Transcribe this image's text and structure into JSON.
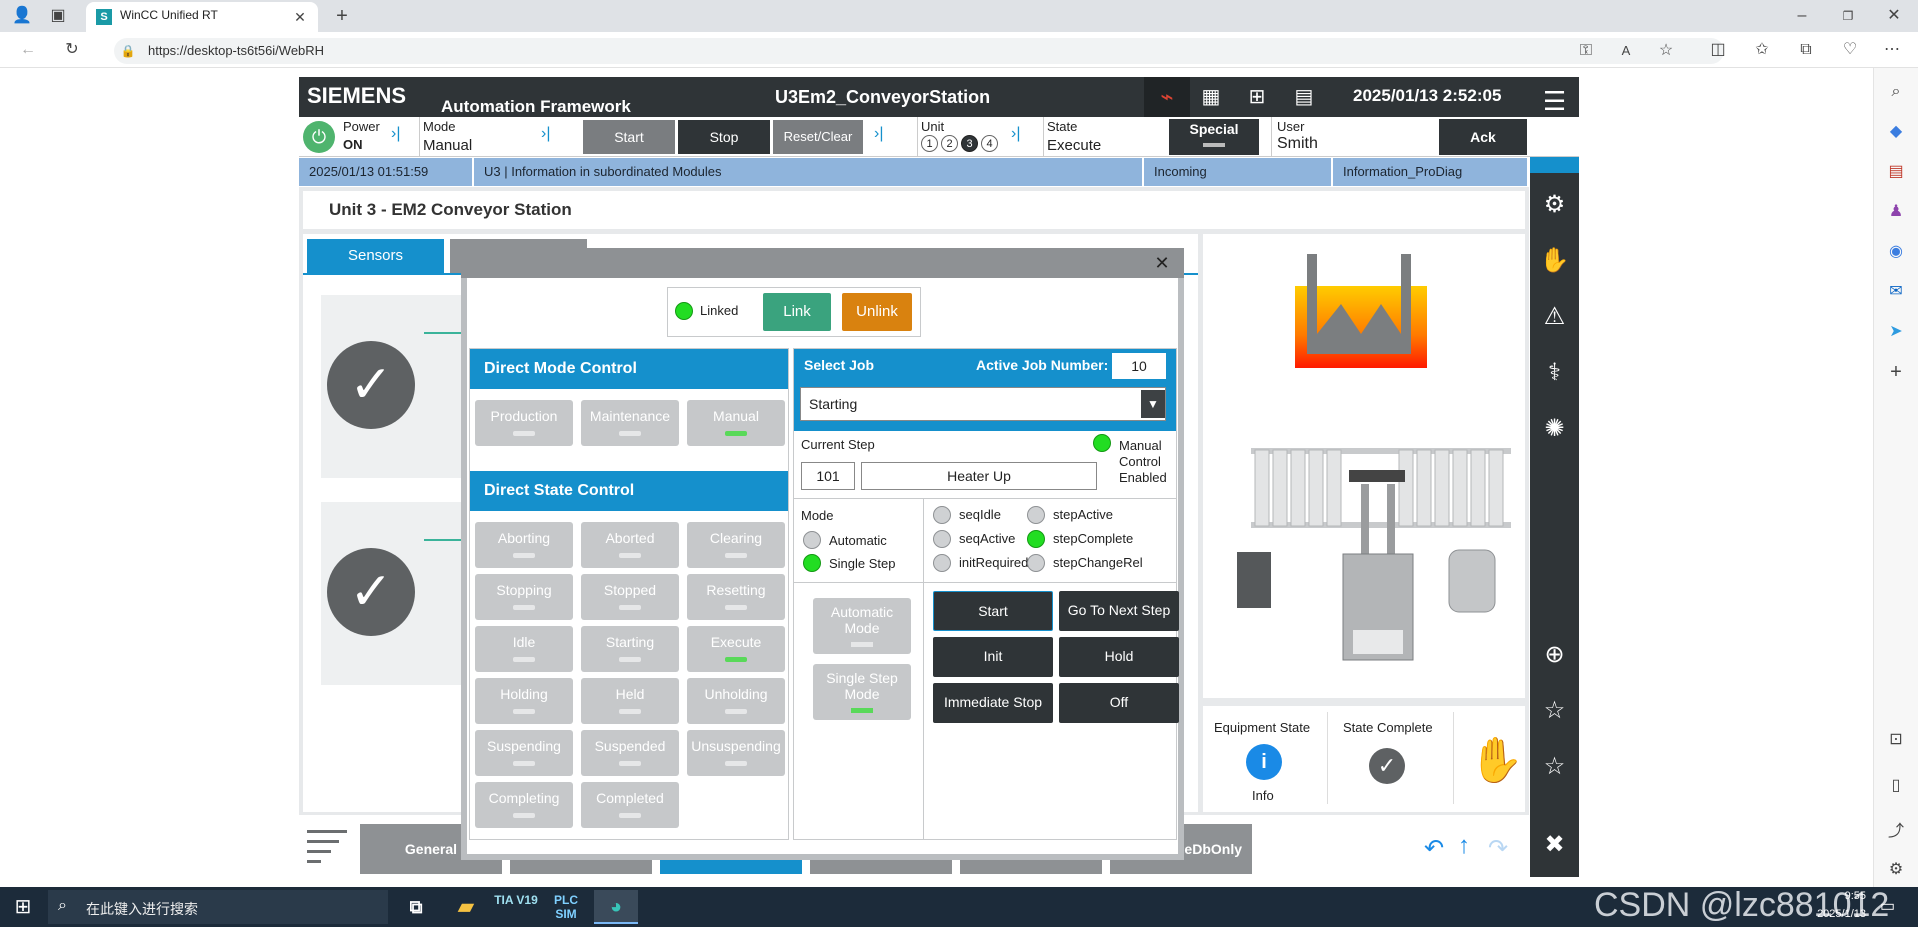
{
  "browser": {
    "tab_title": "WinCC Unified RT",
    "url": "https://desktop-ts6t56i/WebRH"
  },
  "header": {
    "brand": "SIEMENS",
    "subtitle": "Automation Framework",
    "station": "U3Em2_ConveyorStation",
    "datetime": "2025/01/13  2:52:05"
  },
  "toolbar": {
    "power_label": "Power",
    "power_value": "ON",
    "mode_label": "Mode",
    "mode_value": "Manual",
    "start": "Start",
    "stop": "Stop",
    "reset": "Reset/Clear",
    "unit_label": "Unit",
    "units": [
      "1",
      "2",
      "3",
      "4"
    ],
    "state_label": "State",
    "state_value": "Execute",
    "special": "Special",
    "user_label": "User",
    "user_value": "Smith",
    "ack": "Ack"
  },
  "alarm": {
    "time": "2025/01/13 01:51:59",
    "text": "U3 | Information in subordinated Modules",
    "status": "Incoming",
    "class": "Information_ProDiag"
  },
  "page": {
    "title": "Unit 3 - EM2 Conveyor Station",
    "tab_sensors": "Sensors",
    "equipment_state_label": "Equipment State",
    "equipment_state_value": "Info",
    "state_complete_label": "State Complete",
    "bottom_tabs": [
      "General",
      "",
      "",
      "",
      "",
      "neDbOnly"
    ]
  },
  "dialog": {
    "linked_label": "Linked",
    "link": "Link",
    "unlink": "Unlink",
    "direct_mode_title": "Direct Mode Control",
    "modes": [
      {
        "label": "Production",
        "active": false
      },
      {
        "label": "Maintenance",
        "active": false
      },
      {
        "label": "Manual",
        "active": true
      }
    ],
    "direct_state_title": "Direct State Control",
    "states": [
      {
        "label": "Aborting",
        "active": false
      },
      {
        "label": "Aborted",
        "active": false
      },
      {
        "label": "Clearing",
        "active": false
      },
      {
        "label": "Stopping",
        "active": false
      },
      {
        "label": "Stopped",
        "active": false
      },
      {
        "label": "Resetting",
        "active": false
      },
      {
        "label": "Idle",
        "active": false
      },
      {
        "label": "Starting",
        "active": false
      },
      {
        "label": "Execute",
        "active": true
      },
      {
        "label": "Holding",
        "active": false
      },
      {
        "label": "Held",
        "active": false
      },
      {
        "label": "Unholding",
        "active": false
      },
      {
        "label": "Suspending",
        "active": false
      },
      {
        "label": "Suspended",
        "active": false
      },
      {
        "label": "Unsuspending",
        "active": false
      },
      {
        "label": "Completing",
        "active": false
      },
      {
        "label": "Completed",
        "active": false
      }
    ],
    "select_job": "Select Job",
    "active_job_label": "Active Job Number:",
    "active_job_value": "10",
    "job_selected": "Starting",
    "current_step_label": "Current Step",
    "step_number": "101",
    "step_name": "Heater Up",
    "manual_control": [
      "Manual",
      "Control",
      "Enabled"
    ],
    "mode_label": "Mode",
    "mode_automatic": "Automatic",
    "mode_single": "Single Step",
    "flags": [
      {
        "label": "seqIdle",
        "on": false
      },
      {
        "label": "stepActive",
        "on": false
      },
      {
        "label": "seqActive",
        "on": false
      },
      {
        "label": "stepComplete",
        "on": true
      },
      {
        "label": "initRequired",
        "on": false
      },
      {
        "label": "stepChangeRel",
        "on": false
      }
    ],
    "auto_mode_btn": "Automatic Mode",
    "single_step_btn": "Single Step Mode",
    "actions": [
      "Start",
      "Go To Next Step",
      "Init",
      "Hold",
      "Immediate Stop",
      "Off"
    ]
  },
  "taskbar": {
    "search_placeholder": "在此键入进行搜索",
    "app_tia": "TIA V19",
    "app_plc": "PLC SIM",
    "time": "9:55",
    "date": "2025/1/13",
    "watermark": "CSDN @lzc881012"
  },
  "colors": {
    "accent": "#1590cc",
    "header_bg": "#2f3437",
    "link_green": "#3aa37e",
    "unlink_orange": "#d9820f",
    "lamp_on": "#22dd22"
  }
}
